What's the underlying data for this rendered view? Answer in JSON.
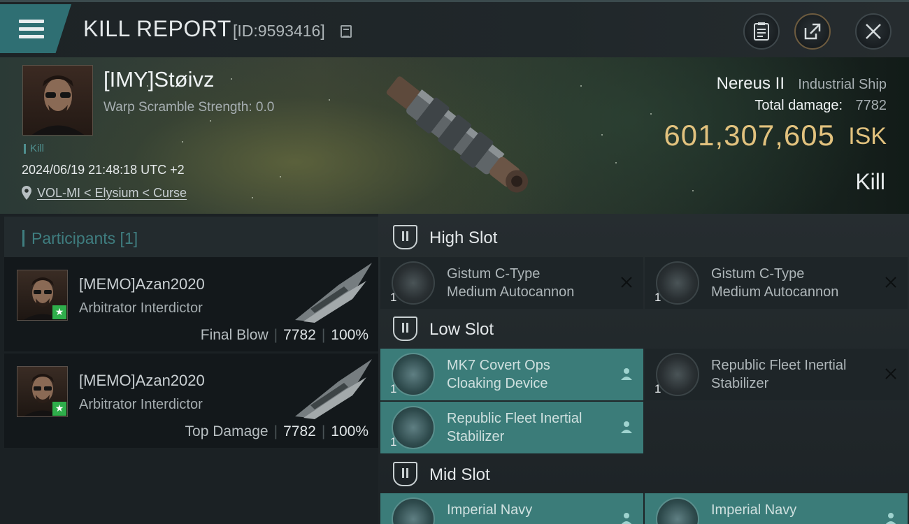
{
  "header": {
    "title": "KILL REPORT",
    "report_id": "[ID:9593416]",
    "icons": [
      "menu-icon",
      "copy-icon",
      "clipboard-icon",
      "share-icon",
      "close-icon"
    ]
  },
  "victim": {
    "name": "[IMY]Støivz",
    "warp_scramble": "Warp Scramble Strength: 0.0",
    "tag": "Kill",
    "timestamp": "2024/06/19 21:48:18 UTC +2",
    "location": "VOL-MI < Elysium < Curse",
    "ship_name": "Nereus II",
    "ship_class": "Industrial Ship",
    "total_damage_label": "Total damage:",
    "total_damage_value": "7782",
    "isk_value": "601,307,605",
    "isk_unit": "ISK",
    "result": "Kill"
  },
  "participants": {
    "title": "Participants [1]",
    "list": [
      {
        "name": "[MEMO]Azan2020",
        "ship": "Arbitrator Interdictor",
        "role": "Final Blow",
        "damage": "7782",
        "percent": "100%"
      },
      {
        "name": "[MEMO]Azan2020",
        "ship": "Arbitrator Interdictor",
        "role": "Top Damage",
        "damage": "7782",
        "percent": "100%"
      }
    ]
  },
  "fitting": {
    "high_slot": {
      "label": "High Slot",
      "modules": [
        {
          "line1": "Gistum C-Type",
          "line2": "Medium Autocannon",
          "qty": "1",
          "status": "destroyed"
        },
        {
          "line1": "Gistum C-Type",
          "line2": "Medium Autocannon",
          "qty": "1",
          "status": "destroyed"
        }
      ]
    },
    "low_slot": {
      "label": "Low Slot",
      "modules": [
        {
          "line1": "MK7 Covert Ops",
          "line2": "Cloaking Device",
          "qty": "1",
          "status": "dropped"
        },
        {
          "line1": "Republic Fleet Inertial",
          "line2": "Stabilizer",
          "qty": "1",
          "status": "destroyed"
        },
        {
          "line1": "Republic Fleet Inertial",
          "line2": "Stabilizer",
          "qty": "1",
          "status": "dropped"
        }
      ]
    },
    "mid_slot": {
      "label": "Mid Slot",
      "modules": [
        {
          "line1": "Imperial Navy",
          "line2": "",
          "qty": "1",
          "status": "dropped"
        },
        {
          "line1": "Imperial Navy",
          "line2": "",
          "qty": "1",
          "status": "dropped"
        }
      ]
    }
  },
  "colors": {
    "accent_teal": "#3f7e80",
    "fitted_bg": "#3b7c79",
    "isk_gold": "#e2c27e",
    "final_blow_badge": "#2fae4b"
  }
}
